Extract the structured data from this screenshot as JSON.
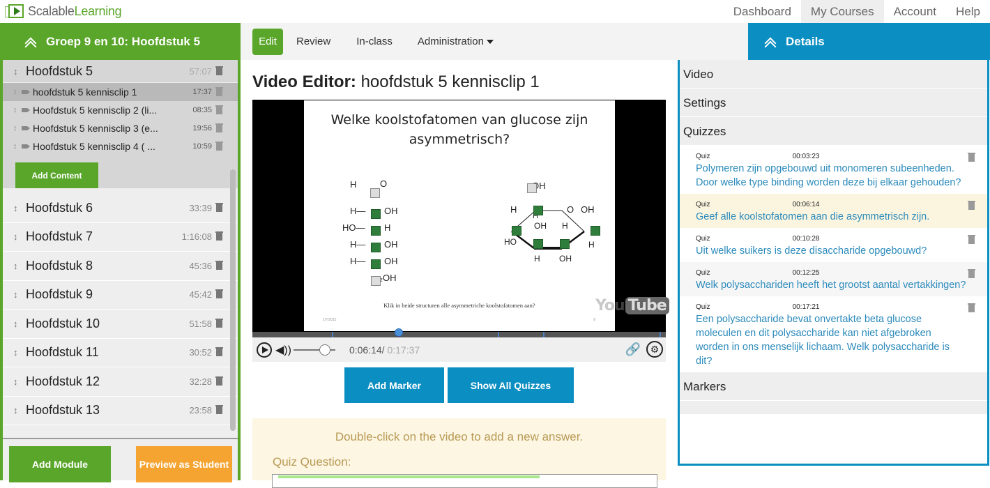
{
  "app": {
    "logo_part1": "Scalable",
    "logo_part2": "Learning"
  },
  "topnav": [
    {
      "label": "Dashboard",
      "active": false
    },
    {
      "label": "My Courses",
      "active": true
    },
    {
      "label": "Account",
      "active": false
    },
    {
      "label": "Help",
      "active": false
    }
  ],
  "sidebar": {
    "title": "Groep 9 en 10: Hoofdstuk 5",
    "open_module": {
      "name": "Hoofdstuk 5",
      "duration": "57:07",
      "items": [
        {
          "name": "hoofdstuk 5 kennisclip 1",
          "duration": "17:37",
          "active": true
        },
        {
          "name": "Hoofdstuk 5 kennisclip 2 (li...",
          "duration": "08:35",
          "active": false
        },
        {
          "name": "Hoofdstuk 5 kennisclip 3 (e...",
          "duration": "19:56",
          "active": false
        },
        {
          "name": "Hoofdstuk 5 kennisclip 4 ( ...",
          "duration": "10:59",
          "active": false
        }
      ],
      "add_content_label": "Add Content"
    },
    "modules": [
      {
        "name": "Hoofdstuk 6",
        "duration": "33:39"
      },
      {
        "name": "Hoofdstuk 7",
        "duration": "1:16:08"
      },
      {
        "name": "Hoofdstuk 8",
        "duration": "45:36"
      },
      {
        "name": "Hoofdstuk 9",
        "duration": "45:42"
      },
      {
        "name": "Hoofdstuk 10",
        "duration": "51:58"
      },
      {
        "name": "Hoofdstuk 11",
        "duration": "30:52"
      },
      {
        "name": "Hoofdstuk 12",
        "duration": "32:28"
      },
      {
        "name": "Hoofdstuk 13",
        "duration": "23:58"
      }
    ],
    "add_module_label": "Add Module",
    "preview_label": "Preview as Student"
  },
  "toolbar": {
    "edit": "Edit",
    "review": "Review",
    "inclass": "In-class",
    "administration": "Administration"
  },
  "main": {
    "title_bold": "Video Editor:",
    "title_rest": " hoofdstuk 5 kennisclip 1",
    "slide": {
      "title_line1": "Welke koolstofatomen van glucose zijn",
      "title_line2": "asymmetrisch?",
      "instruction": "Klik in beide structuren alle asymmetriche koolstofatomen aan?",
      "date": "1/7/2015",
      "number": "8"
    },
    "youtube_you": "You",
    "youtube_tube": "Tube",
    "player": {
      "current_time": "0:06:14/",
      "total_time": " 0:17:37",
      "progress": 0.354,
      "volume": 0.75,
      "quiz_marks": [
        0.192,
        0.354,
        0.593,
        0.704,
        0.985
      ]
    },
    "add_marker_label": "Add Marker",
    "show_all_quizzes_label": "Show All Quizzes",
    "quiz_hint": "Double-click on the video to add a new answer.",
    "quiz_question_label": "Quiz Question:"
  },
  "details": {
    "title": "Details",
    "sections": {
      "video": "Video",
      "settings": "Settings",
      "quizzes": "Quizzes",
      "markers": "Markers"
    },
    "quizzes": [
      {
        "type": "Quiz",
        "time": "00:03:23",
        "question": "Polymeren zijn opgebouwd uit monomeren subeenheden. Door welke type binding worden deze bij elkaar gehouden?",
        "style": ""
      },
      {
        "type": "Quiz",
        "time": "00:06:14",
        "question": "Geef alle koolstofatomen aan die asymmetrisch zijn.",
        "style": "hl"
      },
      {
        "type": "Quiz",
        "time": "00:10:28",
        "question": "Uit welke suikers is deze disaccharide opgebouwd?",
        "style": ""
      },
      {
        "type": "Quiz",
        "time": "00:12:25",
        "question": "Welk polysacchariden heeft het grootst aantal vertakkingen?",
        "style": "alt"
      },
      {
        "type": "Quiz",
        "time": "00:17:21",
        "question": "Een polysaccharide bevat onvertakte beta glucose moleculen en dit polysaccharide kan niet afgebroken worden in ons menselijk lichaam. Welk polysaccharide is dit?",
        "style": ""
      }
    ]
  }
}
